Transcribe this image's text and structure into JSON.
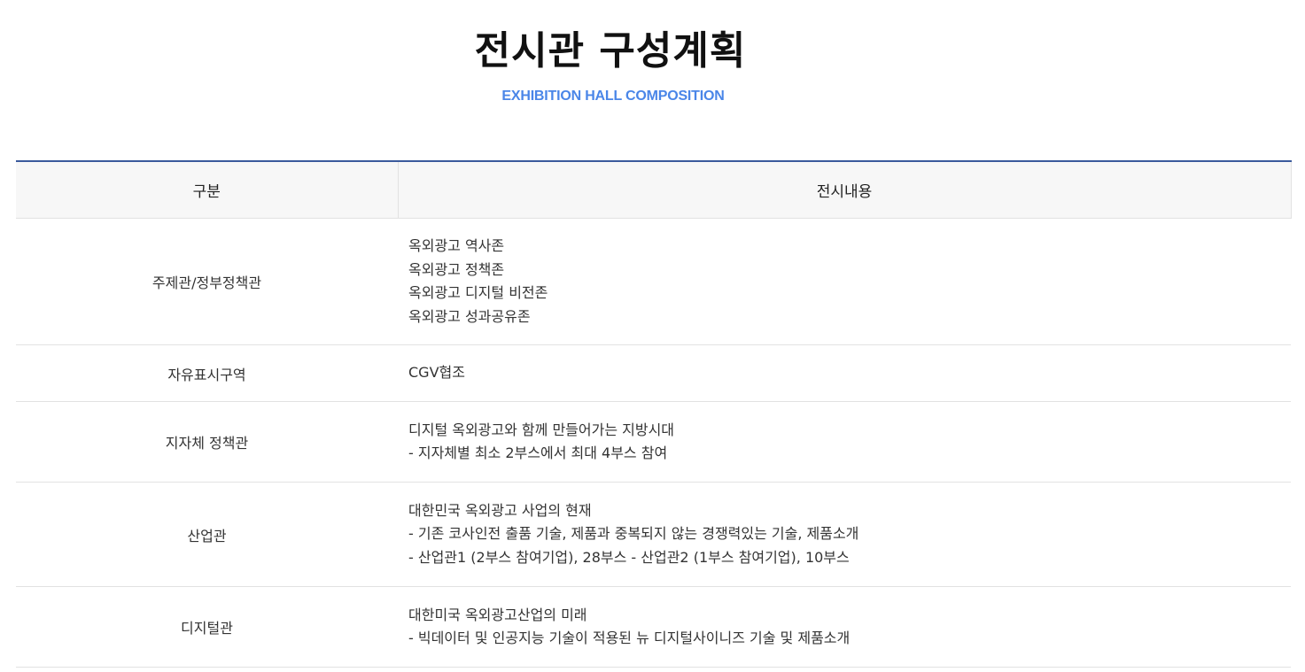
{
  "header": {
    "title": "전시관 구성계획",
    "subtitle": "EXHIBITION HALL COMPOSITION"
  },
  "table": {
    "columns": [
      "구분",
      "전시내용"
    ],
    "rows": [
      {
        "category": "주제관/정부정책관",
        "lines": [
          "옥외광고 역사존",
          "옥외광고 정책존",
          "옥외광고 디지털 비전존",
          "옥외광고 성과공유존"
        ]
      },
      {
        "category": "자유표시구역",
        "lines": [
          "CGV협조"
        ]
      },
      {
        "category": "지자체 정책관",
        "lines": [
          "디지털 옥외광고와 함께 만들어가는 지방시대",
          "- 지자체별 최소 2부스에서 최대 4부스 참여"
        ]
      },
      {
        "category": "산업관",
        "lines": [
          "대한민국 옥외광고 사업의 현재",
          "- 기존 코사인전 출품 기술, 제품과 중복되지 않는 경쟁력있는 기술, 제품소개",
          "- 산업관1 (2부스 참여기업), 28부스 - 산업관2 (1부스 참여기업), 10부스"
        ]
      },
      {
        "category": "디지털관",
        "lines": [
          "대한미국 옥외광고산업의 미래",
          "- 빅데이터 및 인공지능 기술이 적용된 뉴 디지털사이니즈 기술 및 제품소개"
        ]
      }
    ]
  },
  "colors": {
    "accent": "#4a86e8",
    "table_top_border": "#3a5a9c",
    "header_bg": "#f7f7f7",
    "divider": "#e2e2e2"
  }
}
